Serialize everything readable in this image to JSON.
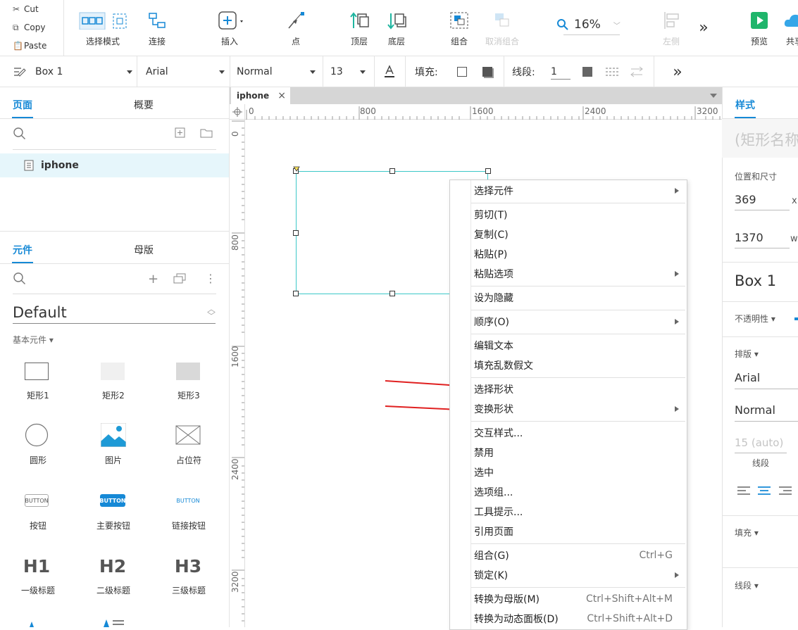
{
  "clipboard": {
    "cut": "Cut",
    "copy": "Copy",
    "paste": "Paste"
  },
  "toolbar": {
    "select_mode": "选择模式",
    "connect": "连接",
    "insert": "插入",
    "point": "点",
    "top_layer": "顶层",
    "bottom_layer": "底层",
    "group": "组合",
    "ungroup": "取消组合",
    "zoom": "16%",
    "left": "左侧",
    "more": "»",
    "preview": "预览",
    "share": "共享"
  },
  "format_bar": {
    "style_name": "Box 1",
    "font_family": "Arial",
    "font_weight": "Normal",
    "font_size": "13",
    "fill_label": "填充:",
    "stroke_label": "线段:",
    "stroke_width": "1",
    "more": "»"
  },
  "pages_panel": {
    "tab_pages": "页面",
    "tab_outline": "概要",
    "page_item": "iphone"
  },
  "widgets_panel": {
    "tab_widgets": "元件",
    "tab_masters": "母版",
    "library": "Default",
    "category": "基本元件 ▾",
    "items": [
      {
        "label": "矩形1"
      },
      {
        "label": "矩形2"
      },
      {
        "label": "矩形3"
      },
      {
        "label": "圆形"
      },
      {
        "label": "图片"
      },
      {
        "label": "占位符"
      },
      {
        "label": "按钮"
      },
      {
        "label": "主要按钮"
      },
      {
        "label": "链接按钮"
      },
      {
        "label": "一级标题"
      },
      {
        "label": "二级标题"
      },
      {
        "label": "三级标题"
      }
    ],
    "button_glyph": "BUTTON",
    "h1": "H1",
    "h2": "H2",
    "h3": "H3"
  },
  "canvas": {
    "tab_title": "iphone",
    "tab_close": "×",
    "ruler_h": [
      "0",
      "800",
      "1600",
      "2400",
      "3200"
    ],
    "ruler_v": [
      "0",
      "800",
      "1600",
      "2400",
      "3200"
    ]
  },
  "context_menu": {
    "items": [
      {
        "label": "选择元件",
        "shortcut": "",
        "submenu": true
      },
      {
        "label": "剪切(T)",
        "shortcut": "",
        "submenu": false
      },
      {
        "label": "复制(C)",
        "shortcut": "",
        "submenu": false
      },
      {
        "label": "粘贴(P)",
        "shortcut": "",
        "submenu": false
      },
      {
        "label": "粘贴选项",
        "shortcut": "",
        "submenu": true
      },
      {
        "label": "设为隐藏",
        "shortcut": "",
        "submenu": false
      },
      {
        "label": "顺序(O)",
        "shortcut": "",
        "submenu": true
      },
      {
        "label": "编辑文本",
        "shortcut": "",
        "submenu": false
      },
      {
        "label": "填充乱数假文",
        "shortcut": "",
        "submenu": false
      },
      {
        "label": "选择形状",
        "shortcut": "",
        "submenu": false
      },
      {
        "label": "变换形状",
        "shortcut": "",
        "submenu": true
      },
      {
        "label": "交互样式...",
        "shortcut": "",
        "submenu": false
      },
      {
        "label": "禁用",
        "shortcut": "",
        "submenu": false
      },
      {
        "label": "选中",
        "shortcut": "",
        "submenu": false
      },
      {
        "label": "选项组...",
        "shortcut": "",
        "submenu": false
      },
      {
        "label": "工具提示...",
        "shortcut": "",
        "submenu": false
      },
      {
        "label": "引用页面",
        "shortcut": "",
        "submenu": false
      },
      {
        "label": "组合(G)",
        "shortcut": "Ctrl+G",
        "submenu": false
      },
      {
        "label": "锁定(K)",
        "shortcut": "",
        "submenu": true
      },
      {
        "label": "转换为母版(M)",
        "shortcut": "Ctrl+Shift+Alt+M",
        "submenu": false
      },
      {
        "label": "转换为动态面板(D)",
        "shortcut": "Ctrl+Shift+Alt+D",
        "submenu": false
      }
    ]
  },
  "style_panel": {
    "tab": "样式",
    "name_placeholder": "(矩形名称)",
    "pos_size_label": "位置和尺寸",
    "x_value": "369",
    "x_axis": "x",
    "w_value": "1370",
    "w_axis": "w",
    "style_name": "Box 1",
    "opacity_label": "不透明性 ▾",
    "typography_label": "排版 ▾",
    "font": "Arial",
    "weight": "Normal",
    "line_height": "15 (auto)",
    "line_label": "线段",
    "fill_label": "填充 ▾",
    "stroke_label": "线段 ▾"
  },
  "colors": {
    "accent": "#1689d6",
    "selection": "#3cc8c8",
    "arrow": "#e02020",
    "preview": "#1fb56b"
  }
}
